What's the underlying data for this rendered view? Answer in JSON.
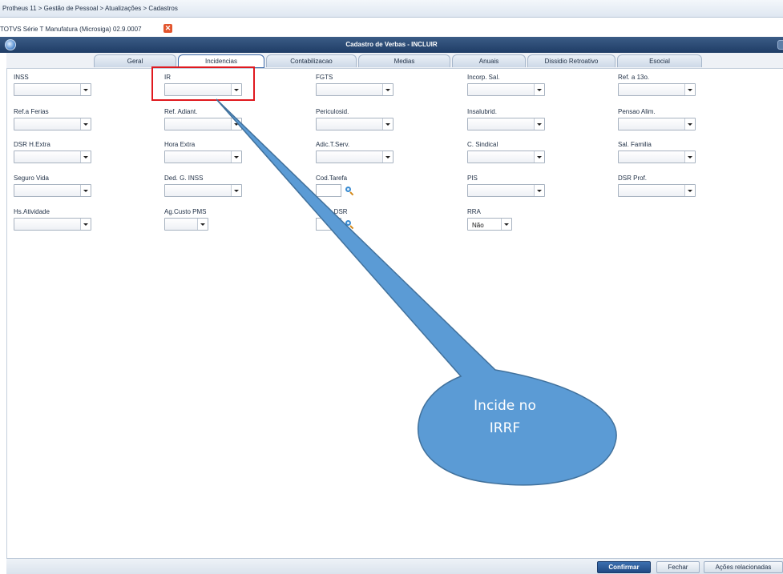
{
  "breadcrumb": "Protheus 11 > Gestão de Pessoal > Atualizações > Cadastros",
  "environment": {
    "label": "TOTVS Série T Manufatura (Microsiga) 02.9.0007",
    "close_icon": "close-icon",
    "close_glyph": "✕"
  },
  "window": {
    "title": "Cadastro de Verbas - INCLUIR"
  },
  "tabs": [
    {
      "label": "Geral"
    },
    {
      "label": "Incidencias",
      "active": true
    },
    {
      "label": "Contabilizacao"
    },
    {
      "label": "Medias"
    },
    {
      "label": "Anuais"
    },
    {
      "label": "Dissidio Retroativo"
    },
    {
      "label": "Esocial"
    }
  ],
  "fields": {
    "inss": {
      "label": "INSS",
      "value": ""
    },
    "ir": {
      "label": "IR",
      "value": ""
    },
    "fgts": {
      "label": "FGTS",
      "value": ""
    },
    "incorp_sal": {
      "label": "Incorp. Sal.",
      "value": ""
    },
    "ref_13o": {
      "label": "Ref. a 13o.",
      "value": ""
    },
    "ref_ferias": {
      "label": "Ref.a Ferias",
      "value": ""
    },
    "ref_adiant": {
      "label": "Ref. Adiant.",
      "value": ""
    },
    "periculosid": {
      "label": "Periculosid.",
      "value": ""
    },
    "insalubrid": {
      "label": "Insalubrid.",
      "value": ""
    },
    "pensao_alim": {
      "label": "Pensao Alim.",
      "value": ""
    },
    "dsr_h_extra": {
      "label": "DSR H.Extra",
      "value": ""
    },
    "hora_extra": {
      "label": "Hora Extra",
      "value": ""
    },
    "adic_t_serv": {
      "label": "Adic.T.Serv.",
      "value": ""
    },
    "c_sindical": {
      "label": "C. Sindical",
      "value": ""
    },
    "sal_familia": {
      "label": "Sal. Familia",
      "value": ""
    },
    "seguro_vida": {
      "label": "Seguro Vida",
      "value": ""
    },
    "ded_g_inss": {
      "label": "Ded. G. INSS",
      "value": ""
    },
    "cod_tarefa": {
      "label": "Cod.Tarefa",
      "value": ""
    },
    "pis": {
      "label": "PIS",
      "value": ""
    },
    "dsr_prof": {
      "label": "DSR Prof.",
      "value": ""
    },
    "hs_atividade": {
      "label": "Hs.Atividade",
      "value": ""
    },
    "ag_custo_pms": {
      "label": "Ag.Custo PMS",
      "value": ""
    },
    "verba_dsr": {
      "label": "a DSR",
      "value": ""
    },
    "rra": {
      "label": "RRA",
      "value": "Não"
    }
  },
  "footer": {
    "confirm_label": "Confirmar",
    "close_label": "Fechar",
    "actions_label": "Ações relacionadas"
  },
  "annotation": {
    "line1": "Incide no",
    "line2": "IRRF",
    "highlight_color": "#e0191f",
    "callout_color": "#5b9bd5",
    "callout_border": "#41719c"
  }
}
